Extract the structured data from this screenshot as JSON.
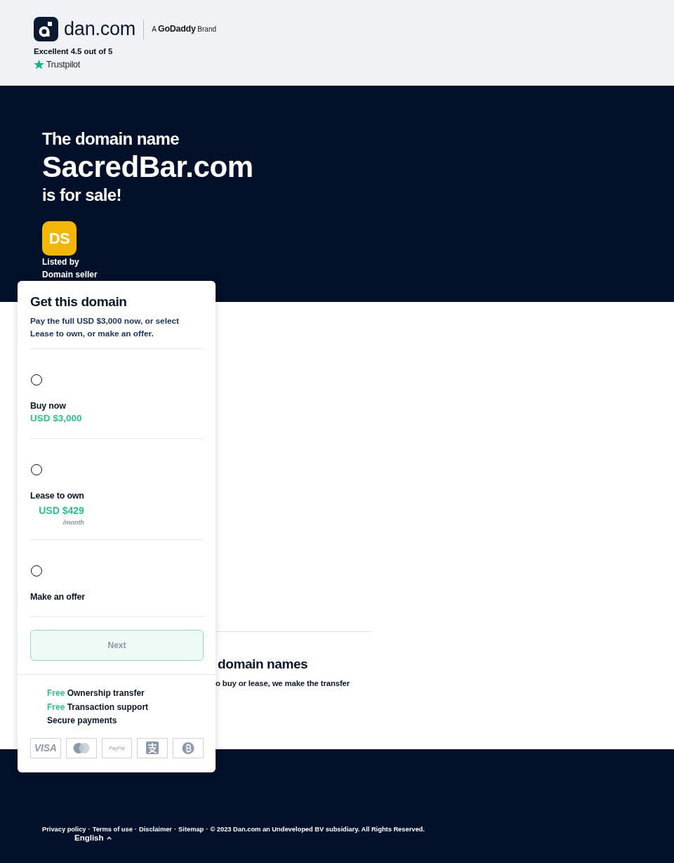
{
  "header": {
    "logo": {
      "wordmark": "dan.com"
    },
    "brand_note": "A **GoDaddy** Brand",
    "rating": "Excellent 4.5 out of 5",
    "review_site": "Trustpilot"
  },
  "hero": {
    "title_lines": [
      "The domain name",
      "SacredBar.com",
      "is for sale!"
    ],
    "seller": {
      "initials": "DS",
      "caption_lines": [
        "Listed by",
        "Domain seller"
      ]
    }
  },
  "purchase_card": {
    "title": "Get this domain",
    "intro": "Pay the full USD $3,000 now, or select Lease to own, or make an offer.",
    "options": [
      {
        "label": "Buy now",
        "price": "USD $3,000",
        "selected": false
      },
      {
        "label": "Lease to own",
        "price": "USD $429",
        "period": "/month",
        "selected": false
      },
      {
        "label": "Make an offer",
        "selected": false
      }
    ],
    "next_button": {
      "label": "Next",
      "disabled": true
    },
    "features": [
      {
        "tag": "Free",
        "label": "Ownership transfer"
      },
      {
        "tag": "Free",
        "label": "Transaction support"
      },
      {
        "label": "Secure payments"
      }
    ],
    "payment_methods": [
      {
        "kind": "visa",
        "label": "VISA"
      },
      {
        "kind": "mastercard"
      },
      {
        "kind": "paypal",
        "label": "PayPal"
      },
      {
        "kind": "alipay"
      },
      {
        "kind": "bitcoin"
      }
    ]
  },
  "info_section": {
    "heading": "domain names",
    "text": "o buy or lease, we make the transfer"
  },
  "footer": {
    "links": [
      "Privacy policy",
      "Terms of use",
      "Disclaimer",
      "Sitemap"
    ],
    "separator": "·",
    "copyright": "© 2023 Dan.com an Undeveloped BV subsidiary. All Rights Reserved.",
    "language": "English"
  }
}
